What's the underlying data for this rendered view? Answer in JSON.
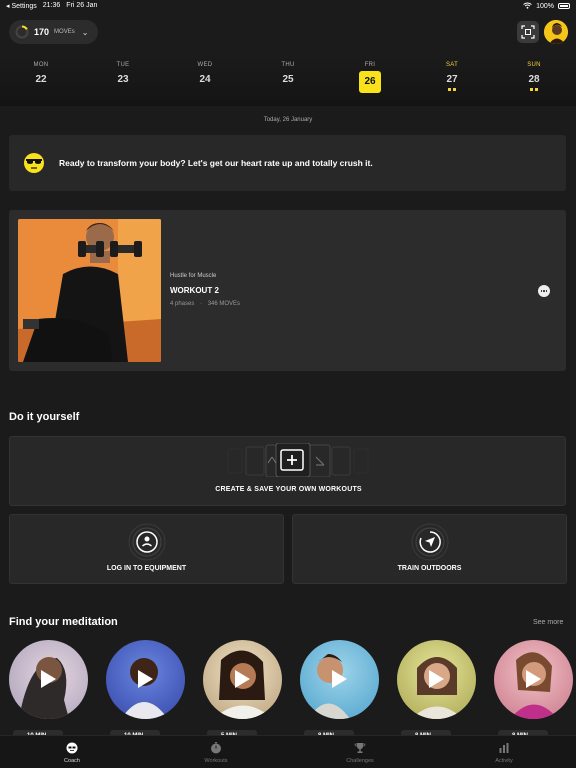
{
  "status_bar": {
    "carrier": "◂ Settings",
    "time": "21:36",
    "date": "Fri 26 Jan",
    "battery": "100%"
  },
  "header": {
    "moves_count": "170",
    "moves_unit": "MOVEs",
    "moves_progress": 0.17
  },
  "week": [
    {
      "name": "MON",
      "num": "22",
      "active": false,
      "weekend": false
    },
    {
      "name": "TUE",
      "num": "23",
      "active": false,
      "weekend": false
    },
    {
      "name": "WED",
      "num": "24",
      "active": false,
      "weekend": false
    },
    {
      "name": "THU",
      "num": "25",
      "active": false,
      "weekend": false
    },
    {
      "name": "FRI",
      "num": "26",
      "active": true,
      "weekend": false
    },
    {
      "name": "SAT",
      "num": "27",
      "active": false,
      "weekend": true
    },
    {
      "name": "SUN",
      "num": "28",
      "active": false,
      "weekend": true
    }
  ],
  "today_label": "Today, 26 January",
  "coach": {
    "message": "Ready to transform your body? Let's get our heart rate up and totally crush it."
  },
  "workout": {
    "program": "Hustle for Muscle",
    "title": "WORKOUT 2",
    "phases": "4 phases",
    "separator": "·",
    "moves": "346 MOVEs"
  },
  "diy": {
    "section_title": "Do it yourself",
    "create_label": "CREATE & SAVE YOUR OWN WORKOUTS",
    "equipment_label": "LOG IN TO EQUIPMENT",
    "outdoors_label": "TRAIN OUTDOORS"
  },
  "meditation": {
    "section_title": "Find your meditation",
    "see_more": "See more",
    "items": [
      {
        "tag": "10 MIN",
        "bg": "#c9b8c8"
      },
      {
        "tag": "10 MIN",
        "bg": "#4a63c9"
      },
      {
        "tag": "5 MIN",
        "bg": "#d9c2a0"
      },
      {
        "tag": "8 MIN",
        "bg": "#6cb4d6"
      },
      {
        "tag": "8 MIN",
        "bg": "#d4d27a"
      },
      {
        "tag": "8 MIN",
        "bg": "#d89aa6"
      }
    ]
  },
  "tabs": [
    {
      "label": "Coach",
      "active": true
    },
    {
      "label": "Workouts",
      "active": false
    },
    {
      "label": "Challenges",
      "active": false
    },
    {
      "label": "Activity",
      "active": false
    }
  ],
  "colors": {
    "accent": "#f9e21b",
    "background": "#1b1b1b",
    "card": "#282828"
  }
}
